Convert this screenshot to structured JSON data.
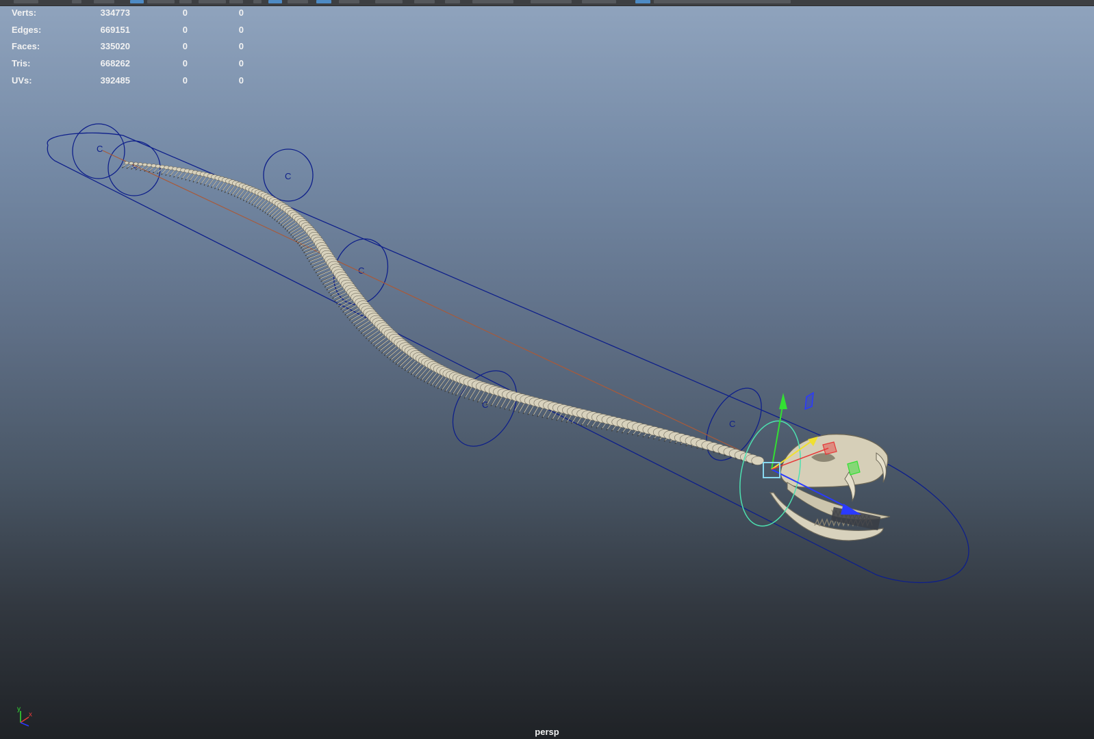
{
  "stats": {
    "rows": [
      {
        "label": "Verts:",
        "total": "334773",
        "selected": "0",
        "subset": "0"
      },
      {
        "label": "Edges:",
        "total": "669151",
        "selected": "0",
        "subset": "0"
      },
      {
        "label": "Faces:",
        "total": "335020",
        "selected": "0",
        "subset": "0"
      },
      {
        "label": "Tris:",
        "total": "668262",
        "selected": "0",
        "subset": "0"
      },
      {
        "label": "UVs:",
        "total": "392485",
        "selected": "0",
        "subset": "0"
      }
    ]
  },
  "viewport": {
    "camera": "persp",
    "axes": {
      "y": "y",
      "x": "x"
    },
    "control_glyph": "C"
  },
  "colors": {
    "control_curve": "#0e1f8a",
    "bone": "#d8d2bd",
    "spine_line": "#a85a3a",
    "gizmo_y": "#33e033",
    "gizmo_x": "#e63a3a",
    "gizmo_z": "#2a3aff",
    "gizmo_ring": "#4de0b0",
    "gizmo_center": "#f0e030"
  }
}
